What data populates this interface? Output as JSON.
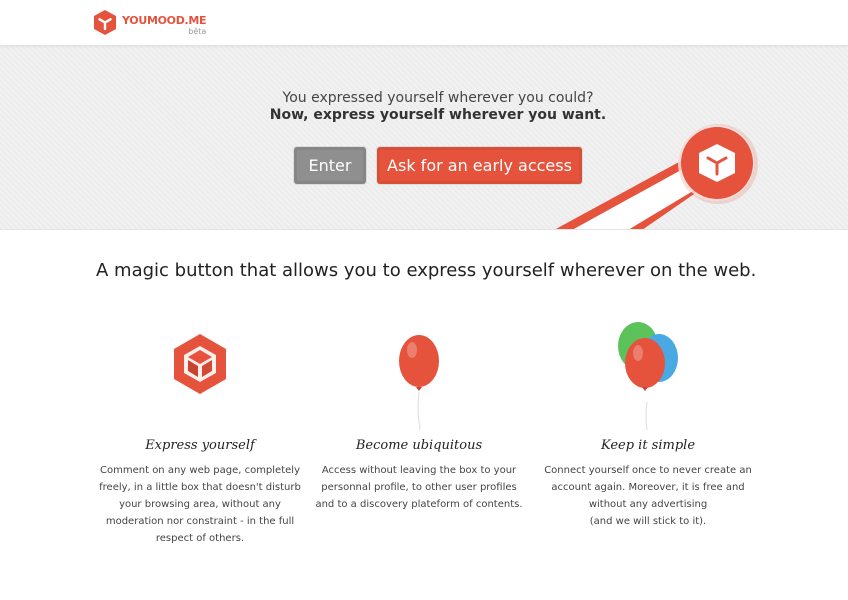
{
  "header": {
    "brand": "YOUMOOD.ME",
    "badge": "bêta"
  },
  "hero": {
    "tagline_line1": "You expressed yourself wherever you could?",
    "tagline_line2": "Now, express yourself wherever you want.",
    "enter_label": "Enter",
    "early_access_label": "Ask for an early access"
  },
  "main": {
    "headline": "A magic button that allows you to express yourself wherever on the web.",
    "features": [
      {
        "title": "Express yourself",
        "description": "Comment on any web page, completely freely, in a little box that doesn't disturb your browsing area, without any moderation nor constraint - in the full respect of others.",
        "icon": "hexagon-logo-icon"
      },
      {
        "title": "Become ubiquitous",
        "description": "Access without leaving the box to your personnal profile, to other user profiles and to a discovery plateform of contents.",
        "icon": "red-balloon-icon"
      },
      {
        "title": "Keep it simple",
        "description": "Connect yourself once to never create an account again. Moreover, it is free and without any advertising\n(and we will stick to it).",
        "icon": "balloons-bunch-icon"
      }
    ]
  },
  "colors": {
    "accent": "#e5533d",
    "enter_button": "#8f8f8f",
    "hero_background": "#f1f1f1",
    "balloon_green": "#5cc35a",
    "balloon_blue": "#49a9e2"
  }
}
